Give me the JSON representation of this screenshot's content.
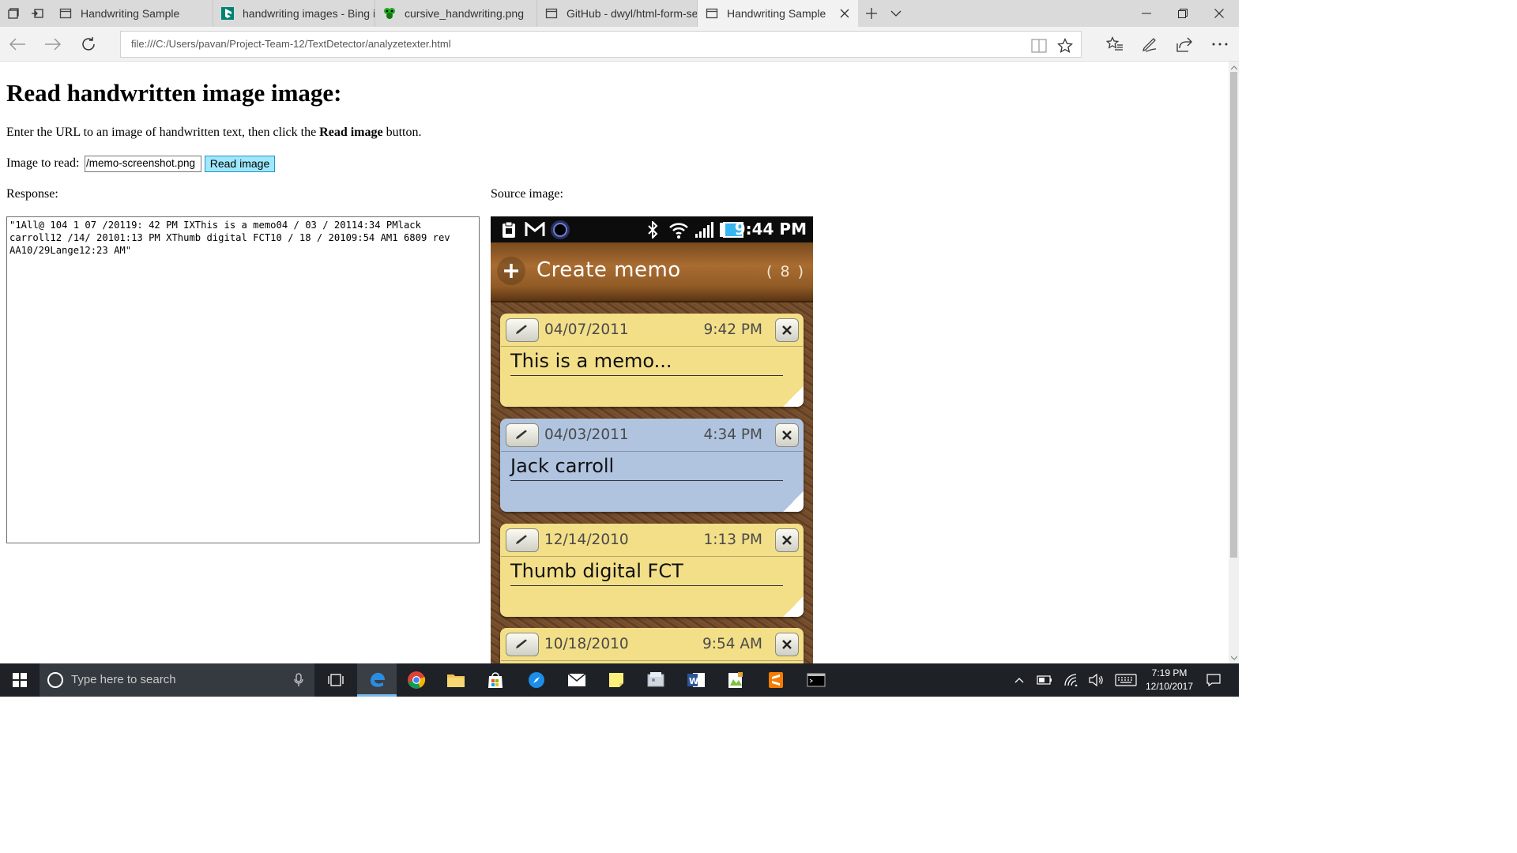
{
  "browser": {
    "tabs": [
      {
        "title": "Handwriting Sample",
        "favicon": "page-icon"
      },
      {
        "title": "handwriting images - Bing i",
        "favicon": "bing-icon"
      },
      {
        "title": "cursive_handwriting.png",
        "favicon": "image-icon"
      },
      {
        "title": "GitHub - dwyl/html-form-se",
        "favicon": "page-icon"
      },
      {
        "title": "Handwriting Sample",
        "favicon": "page-icon",
        "active": true
      }
    ],
    "address": "file:///C:/Users/pavan/Project-Team-12/TextDetector/analyzetexter.html"
  },
  "page": {
    "heading": "Read handwritten image image:",
    "intro_prefix": "Enter the URL to an image of handwritten text, then click the ",
    "intro_bold": "Read image",
    "intro_suffix": " button.",
    "image_label": "Image to read:",
    "image_url_value": "/memo-screenshot.png",
    "read_button": "Read image",
    "response_label": "Response:",
    "source_label": "Source image:",
    "response_text": "\"1All@ 104 1 07 /20119: 42 PM IXThis is a memo04 / 03 / 20114:34 PMlack carroll12 /14/ 20101:13 PM XThumb digital FCT10 / 18 / 20109:54 AM1 6809 rev AA10/29Lange12:23 AM\""
  },
  "source_image": {
    "status_time": "9:44 PM",
    "header_title": "Create memo",
    "header_count": "( 8 )",
    "memos": [
      {
        "date": "04/07/2011",
        "time": "9:42 PM",
        "text": "This is a memo...",
        "color": "yellow"
      },
      {
        "date": "04/03/2011",
        "time": "4:34 PM",
        "text": "Jack carroll",
        "color": "blue"
      },
      {
        "date": "12/14/2010",
        "time": "1:13 PM",
        "text": "Thumb digital FCT",
        "color": "yellow"
      },
      {
        "date": "10/18/2010",
        "time": "9:54 AM",
        "text": "",
        "color": "yellow"
      }
    ]
  },
  "taskbar": {
    "search_placeholder": "Type here to search",
    "time": "7:19 PM",
    "date": "12/10/2017"
  },
  "colors": {
    "read_button_bg": "#9fe8fb",
    "memo_yellow": "#f3df88",
    "memo_blue": "#b0c4e0",
    "taskbar_bg": "#1e2126"
  }
}
